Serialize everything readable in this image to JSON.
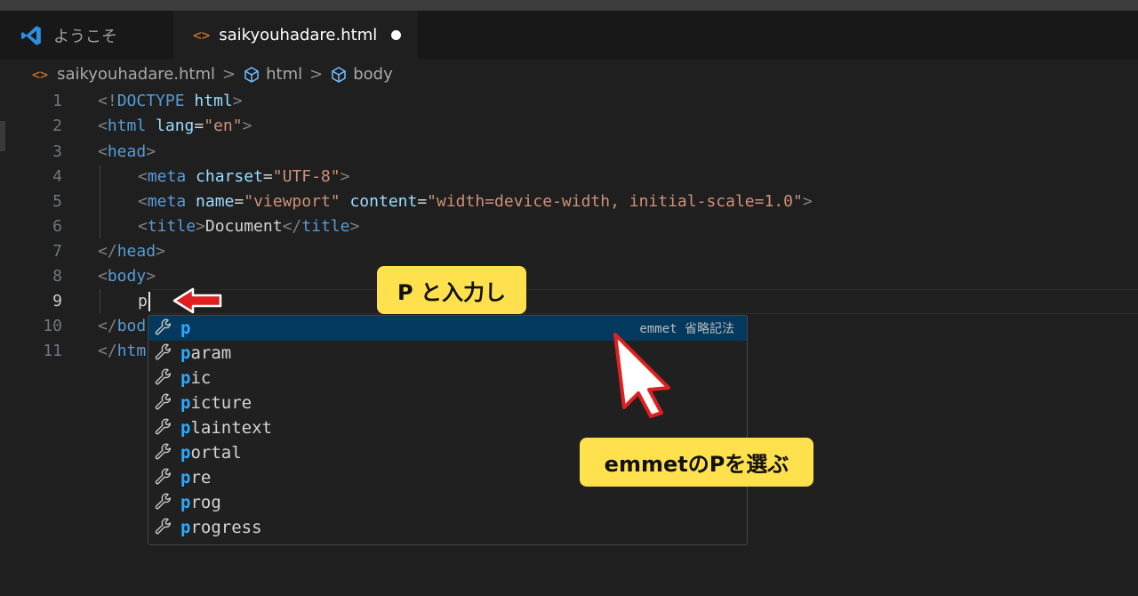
{
  "tabs": [
    {
      "label": "ようこそ",
      "active": false
    },
    {
      "label": "saikyouhadare.html",
      "active": true,
      "unsaved": true
    }
  ],
  "breadcrumb": [
    "saikyouhadare.html",
    "html",
    "body"
  ],
  "icons": {
    "html_file": "<>",
    "breadcrumb_sep": ">"
  },
  "gutter": [
    "1",
    "2",
    "3",
    "4",
    "5",
    "6",
    "7",
    "8",
    "9",
    "10",
    "11"
  ],
  "code": {
    "l1": {
      "a": "<!",
      "b": "DOCTYPE",
      "c": "html",
      "d": ">"
    },
    "l2": {
      "a": "<",
      "b": "html",
      "c": "lang",
      "d": "=",
      "e": "\"en\"",
      "f": ">"
    },
    "l3": {
      "a": "<",
      "b": "head",
      "c": ">"
    },
    "l4": {
      "a": "<",
      "b": "meta",
      "c": "charset",
      "d": "=",
      "e": "\"UTF-8\"",
      "f": ">"
    },
    "l5": {
      "a": "<",
      "b": "meta",
      "c": "name",
      "d": "=",
      "e": "\"viewport\"",
      "f": "content",
      "g": "=",
      "h": "\"width=device-width, initial-scale=1.0\"",
      "i": ">"
    },
    "l6": {
      "a": "<",
      "b": "title",
      "c": ">",
      "d": "Document",
      "e": "</",
      "f": "title",
      "g": ">"
    },
    "l7": {
      "a": "</",
      "b": "head",
      "c": ">"
    },
    "l8": {
      "a": "<",
      "b": "body",
      "c": ">"
    },
    "l9": {
      "a": "p"
    },
    "l10": {
      "a": "</",
      "b": "bod"
    },
    "l11": {
      "a": "</",
      "b": "htm"
    }
  },
  "suggestions": [
    {
      "hl": "p",
      "rest": "",
      "detail": "emmet 省略記法",
      "selected": true
    },
    {
      "hl": "p",
      "rest": "aram"
    },
    {
      "hl": "p",
      "rest": "ic"
    },
    {
      "hl": "p",
      "rest": "icture"
    },
    {
      "hl": "p",
      "rest": "laintext"
    },
    {
      "hl": "p",
      "rest": "ortal"
    },
    {
      "hl": "p",
      "rest": "re"
    },
    {
      "hl": "p",
      "rest": "rog"
    },
    {
      "hl": "p",
      "rest": "rogress"
    }
  ],
  "annotations": {
    "callout1": "P と入力し",
    "callout2": "emmetのPを選ぶ"
  },
  "colors": {
    "accent_selection": "#04395e",
    "match_highlight": "#2aaaff",
    "callout_bg": "#ffe14d",
    "arrow_red": "#e02020"
  }
}
